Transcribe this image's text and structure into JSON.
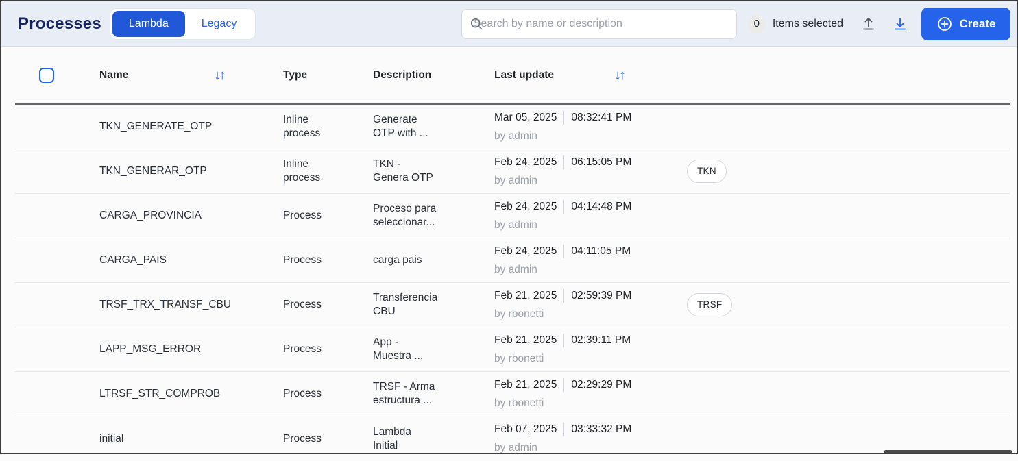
{
  "colors": {
    "accent_blue": "#2563eb",
    "toggle_active_bg": "#2158d8",
    "title_navy": "#16255e",
    "header_bg": "#e9eef6",
    "muted_gray": "#9ba1aa"
  },
  "header": {
    "title": "Processes",
    "toggle": {
      "options": [
        {
          "label": "Lambda",
          "active": true
        },
        {
          "label": "Legacy",
          "active": false
        }
      ]
    },
    "search": {
      "placeholder": "Search by name or description"
    },
    "selection": {
      "count": "0",
      "label": "Items selected"
    },
    "create_label": "Create"
  },
  "table": {
    "columns": [
      {
        "label": "Name",
        "sortable": true
      },
      {
        "label": "Type",
        "sortable": false
      },
      {
        "label": "Description",
        "sortable": false
      },
      {
        "label": "Last update",
        "sortable": true
      }
    ],
    "sort_glyph": "↓↑",
    "rows": [
      {
        "name": "TKN_GENERATE_OTP",
        "type": "Inline\nprocess",
        "description": "Generate\nOTP with ...",
        "date": "Mar 05, 2025",
        "time": "08:32:41 PM",
        "by": "by admin",
        "tag": ""
      },
      {
        "name": "TKN_GENERAR_OTP",
        "type": "Inline\nprocess",
        "description": "TKN -\nGenera OTP",
        "date": "Feb 24, 2025",
        "time": "06:15:05 PM",
        "by": "by admin",
        "tag": "TKN"
      },
      {
        "name": "CARGA_PROVINCIA",
        "type": "Process",
        "description": "Proceso para\nseleccionar...",
        "date": "Feb 24, 2025",
        "time": "04:14:48 PM",
        "by": "by admin",
        "tag": ""
      },
      {
        "name": "CARGA_PAIS",
        "type": "Process",
        "description": "carga pais",
        "date": "Feb 24, 2025",
        "time": "04:11:05 PM",
        "by": "by admin",
        "tag": ""
      },
      {
        "name": "TRSF_TRX_TRANSF_CBU",
        "type": "Process",
        "description": "Transferencia\nCBU",
        "date": "Feb 21, 2025",
        "time": "02:59:39 PM",
        "by": "by rbonetti",
        "tag": "TRSF"
      },
      {
        "name": "LAPP_MSG_ERROR",
        "type": "Process",
        "description": "App -\nMuestra ...",
        "date": "Feb 21, 2025",
        "time": "02:39:11 PM",
        "by": "by rbonetti",
        "tag": ""
      },
      {
        "name": "LTRSF_STR_COMPROB",
        "type": "Process",
        "description": "TRSF - Arma\nestructura ...",
        "date": "Feb 21, 2025",
        "time": "02:29:29 PM",
        "by": "by rbonetti",
        "tag": ""
      },
      {
        "name": "initial",
        "type": "Process",
        "description": "Lambda\nInitial",
        "date": "Feb 07, 2025",
        "time": "03:33:32 PM",
        "by": "by admin",
        "tag": ""
      }
    ]
  }
}
